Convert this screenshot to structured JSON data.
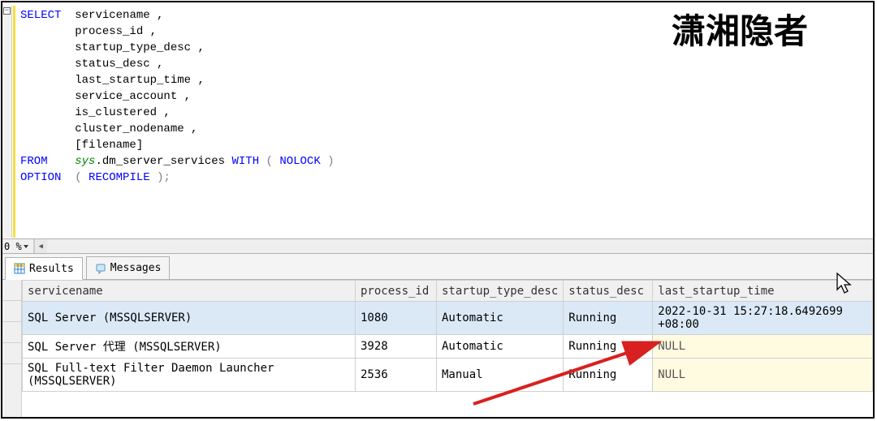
{
  "watermark": "潇湘隐者",
  "zoom": {
    "label": "0 %"
  },
  "sql": {
    "keywords": {
      "select": "SELECT",
      "from": "FROM",
      "option": "OPTION",
      "with": "WITH",
      "nolock": "NOLOCK",
      "recompile": "RECOMPILE"
    },
    "schema": "sys",
    "dot": ".",
    "object": "dm_server_services",
    "cols": {
      "c0": "servicename ,",
      "c1": "process_id ,",
      "c2": "startup_type_desc ,",
      "c3": "status_desc ,",
      "c4": "last_startup_time ,",
      "c5": "service_account ,",
      "c6": "is_clustered ,",
      "c7": "cluster_nodename ,",
      "c8": "[filename]"
    },
    "paren_open": "(",
    "paren_close": ")",
    "semicolon": ";"
  },
  "tabs": {
    "results": "Results",
    "messages": "Messages"
  },
  "grid": {
    "headers": {
      "h0": "servicename",
      "h1": "process_id",
      "h2": "startup_type_desc",
      "h3": "status_desc",
      "h4": "last_startup_time"
    },
    "rows": [
      {
        "c0": "SQL Server (MSSQLSERVER)",
        "c1": "1080",
        "c2": "Automatic",
        "c3": "Running",
        "c4": "2022-10-31 15:27:18.6492699 +08:00",
        "null4": false
      },
      {
        "c0": "SQL Server 代理 (MSSQLSERVER)",
        "c1": "3928",
        "c2": "Automatic",
        "c3": "Running",
        "c4": "NULL",
        "null4": true
      },
      {
        "c0": "SQL Full-text Filter Daemon Launcher (MSSQLSERVER)",
        "c1": "2536",
        "c2": "Manual",
        "c3": "Running",
        "c4": "NULL",
        "null4": true
      }
    ]
  },
  "collapse_glyph": "−"
}
